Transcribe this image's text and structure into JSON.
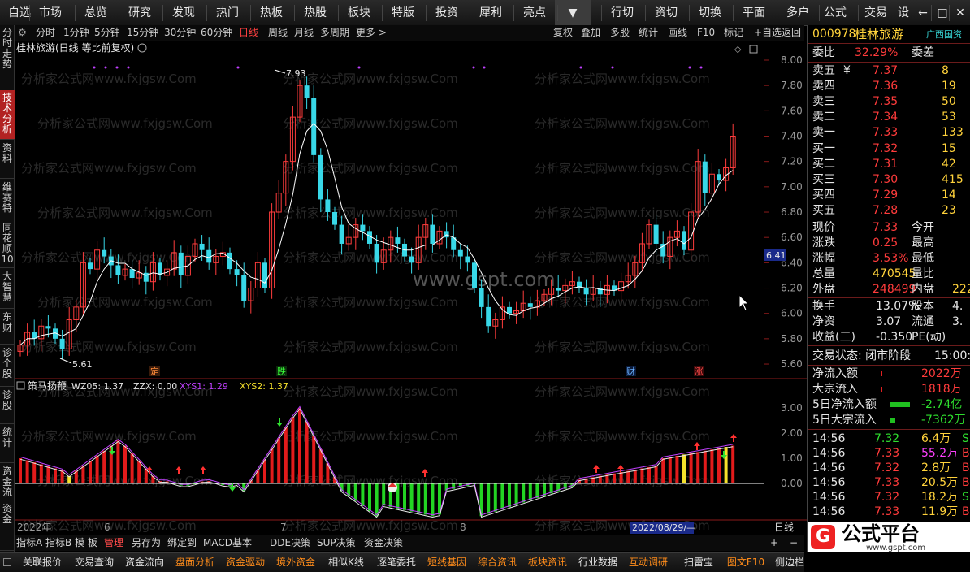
{
  "topbar": {
    "items": [
      "自选",
      "市场",
      "总览",
      "研究",
      "发现",
      "热门",
      "热板",
      "热股",
      "板块",
      "特版",
      "投资",
      "犀利",
      "亮点",
      "▼",
      "行切",
      "资切",
      "切换",
      "平面",
      "多户",
      "公式",
      "交易",
      "设",
      "←",
      "□",
      "✕"
    ]
  },
  "periods": {
    "items": [
      "分时",
      "1分钟",
      "5分钟",
      "15分钟",
      "30分钟",
      "60分钟",
      "日线",
      "周线",
      "月线",
      "多周期",
      "更多 >"
    ],
    "active": "日线",
    "tools": [
      "复权",
      "叠加",
      "多股",
      "统计",
      "画线",
      "F10",
      "标记",
      "+自选",
      "返回"
    ]
  },
  "leftbar": {
    "tabs": [
      "分时走势",
      "技术分析",
      "资料",
      "维赛特",
      "同花顺10",
      "大智慧",
      "东财",
      "诊个股",
      "诊股",
      "统计",
      "资金流",
      "资金"
    ],
    "active": "技术分析"
  },
  "chart": {
    "title": "桂林旅游(日线 等比前复权)",
    "high_label": "7.93",
    "low_label": "5.61",
    "current_price_tag": "6.41",
    "watermark": "www.gspt.com",
    "watermark_row": "分析家公式网www.fxjgsw.Com",
    "event_labels": [
      "定",
      "跌",
      "财",
      "涨"
    ],
    "y_ticks": [
      "8.00",
      "7.80",
      "7.60",
      "7.40",
      "7.20",
      "7.00",
      "6.80",
      "6.60",
      "6.40",
      "6.20",
      "6.00",
      "5.80",
      "5.60"
    ],
    "indicator": {
      "name": "策马扬鞭",
      "wz05": "WZ05: 1.37",
      "zzx": "ZZX: 0.00",
      "xys1": "XYS1: 1.29",
      "xys2": "XYS2: 1.37",
      "y_ticks": [
        "3.00",
        "2.00",
        "1.00",
        "0.00"
      ]
    },
    "x_labels": [
      "2022年",
      "6",
      "7",
      "8"
    ],
    "date_cursor": "2022/08/29/—",
    "period_label": "日线",
    "colors": {
      "up": "#ff3c3c",
      "down": "#38d8e8",
      "ma": "#ffffff",
      "osc_up": "#e21b1b",
      "osc_down": "#23d423",
      "osc_yellow": "#f5e12b",
      "purple": "#c040ff"
    }
  },
  "chart_data": {
    "type": "candlestick",
    "closes": [
      5.75,
      5.85,
      5.8,
      5.9,
      5.88,
      5.8,
      5.72,
      5.95,
      6.05,
      6.4,
      6.35,
      6.5,
      6.45,
      6.38,
      6.3,
      6.35,
      6.28,
      6.32,
      6.25,
      6.4,
      6.3,
      6.35,
      6.48,
      6.3,
      6.45,
      6.55,
      6.5,
      6.4,
      6.45,
      6.48,
      6.35,
      6.3,
      6.1,
      6.2,
      6.4,
      6.2,
      6.8,
      6.95,
      7.2,
      7.55,
      7.8,
      7.7,
      7.25,
      6.9,
      6.8,
      6.7,
      6.55,
      6.6,
      6.7,
      6.65,
      6.55,
      6.4,
      6.5,
      6.6,
      6.55,
      6.45,
      6.4,
      6.6,
      6.7,
      6.55,
      6.65,
      6.6,
      6.5,
      6.45,
      6.4,
      6.2,
      6.05,
      5.9,
      5.95,
      6.05,
      6.0,
      6.02,
      6.08,
      6.05,
      6.1,
      6.15,
      6.2,
      6.18,
      6.22,
      6.25,
      6.2,
      6.15,
      6.2,
      6.15,
      6.22,
      6.18,
      6.25,
      6.3,
      6.4,
      6.55,
      6.7,
      6.55,
      6.45,
      6.6,
      6.65,
      6.5,
      6.8,
      7.2,
      6.95,
      7.1,
      7.05,
      7.15,
      7.4
    ]
  },
  "bottom": {
    "index_tabs": [
      "指标A",
      "指标B",
      "模 板",
      "管理",
      "另存为",
      "绑定到",
      "MACD基本",
      "DDE决策",
      "SUP决策",
      "资金决策"
    ],
    "active_index": "管理",
    "func_tabs": [
      "关联报价",
      "交易查询",
      "资金流向",
      "盘面分析",
      "资金驱动",
      "境外资金",
      "相似K线",
      "逐笔委托",
      "短线基因",
      "综合资讯",
      "板块资讯",
      "行业数据",
      "互动调研",
      "扫雷宝",
      "图文F10",
      "侧边栏"
    ],
    "orange_tabs": [
      "盘面分析",
      "资金驱动",
      "境外资金",
      "短线基因",
      "综合资讯",
      "板块资讯",
      "互动调研",
      "图文F10"
    ]
  },
  "quote": {
    "code": "000978",
    "name": "桂林旅游",
    "tag": "广西国资",
    "weibi_label": "委比",
    "weibi": "32.29%",
    "weicha_label": "委差",
    "asks": [
      {
        "label": "卖五",
        "mark": "¥",
        "price": "7.37",
        "vol": "8"
      },
      {
        "label": "卖四",
        "mark": "",
        "price": "7.36",
        "vol": "19"
      },
      {
        "label": "卖三",
        "mark": "",
        "price": "7.35",
        "vol": "50"
      },
      {
        "label": "卖二",
        "mark": "",
        "price": "7.34",
        "vol": "53"
      },
      {
        "label": "卖一",
        "mark": "",
        "price": "7.33",
        "vol": "133"
      }
    ],
    "bids": [
      {
        "label": "买一",
        "price": "7.32",
        "vol": "15"
      },
      {
        "label": "买二",
        "price": "7.31",
        "vol": "42"
      },
      {
        "label": "买三",
        "price": "7.30",
        "vol": "415"
      },
      {
        "label": "买四",
        "price": "7.29",
        "vol": "14"
      },
      {
        "label": "买五",
        "price": "7.28",
        "vol": "23"
      }
    ],
    "stats": [
      {
        "l": "现价",
        "v": "7.33",
        "vc": "red",
        "r": "今开",
        "rv": ""
      },
      {
        "l": "涨跌",
        "v": "0.25",
        "vc": "red",
        "r": "最高",
        "rv": ""
      },
      {
        "l": "涨幅",
        "v": "3.53%",
        "vc": "red",
        "r": "最低",
        "rv": ""
      },
      {
        "l": "总量",
        "v": "470545",
        "vc": "yellow",
        "r": "量比",
        "rv": ""
      },
      {
        "l": "外盘",
        "v": "248499",
        "vc": "red",
        "r": "内盘",
        "rv": "222"
      }
    ],
    "stats2": [
      {
        "l": "换手",
        "v": "13.07%",
        "r": "股本",
        "rv": "4."
      },
      {
        "l": "净资",
        "v": "3.07",
        "r": "流通",
        "rv": "3."
      },
      {
        "l": "收益(三)",
        "v": "-0.350",
        "r": "PE(动)",
        "rv": ""
      }
    ],
    "trade_status": "交易状态: 闭市阶段",
    "trade_time": "15:00:0",
    "flows": [
      {
        "l": "净流入额",
        "v": "2022万",
        "c": "red"
      },
      {
        "l": "大宗流入",
        "v": "1818万",
        "c": "red"
      },
      {
        "l": "5日净流入额",
        "v": "-2.74亿",
        "c": "green"
      },
      {
        "l": "5日大宗流入",
        "v": "-7362万",
        "c": "green"
      }
    ],
    "ticks": [
      {
        "t": "14:56",
        "p": "7.32",
        "pc": "green",
        "v": "6.4万",
        "vc": "yellow",
        "d": "S",
        "dc": "green"
      },
      {
        "t": "14:56",
        "p": "7.33",
        "pc": "red",
        "v": "55.2万",
        "vc": "magenta",
        "d": "B",
        "dc": "red"
      },
      {
        "t": "14:56",
        "p": "7.32",
        "pc": "red",
        "v": "2.8万",
        "vc": "yellow",
        "d": "B",
        "dc": "red"
      },
      {
        "t": "14:56",
        "p": "7.33",
        "pc": "red",
        "v": "20.5万",
        "vc": "yellow",
        "d": "B",
        "dc": "red"
      },
      {
        "t": "14:56",
        "p": "7.32",
        "pc": "red",
        "v": "18.2万",
        "vc": "yellow",
        "d": "S",
        "dc": "green"
      },
      {
        "t": "14:56",
        "p": "7.33",
        "pc": "red",
        "v": "11.9万",
        "vc": "yellow",
        "d": "B",
        "dc": "red"
      }
    ]
  },
  "logo": {
    "text": "公式平台",
    "url": "www.gspt.com"
  }
}
